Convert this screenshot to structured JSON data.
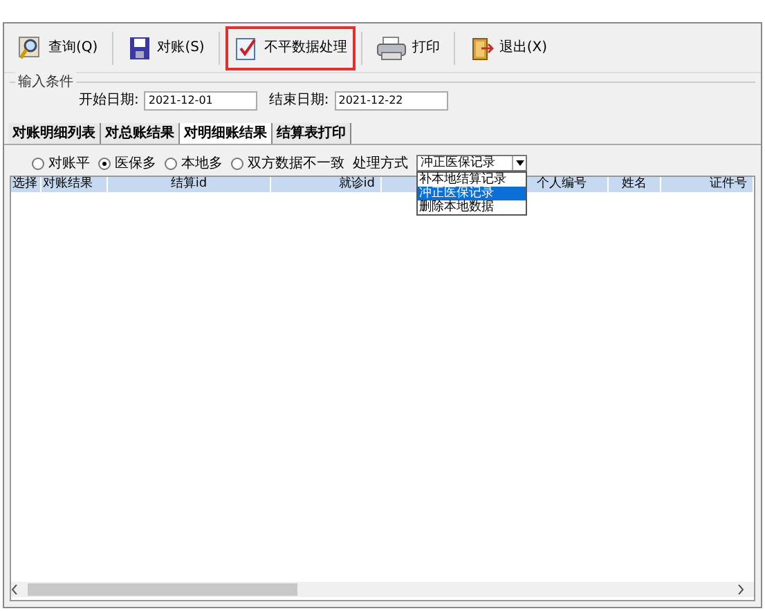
{
  "toolbar": [
    {
      "label": "查询(Q)",
      "highlighted": false
    },
    {
      "label": "对账(S)",
      "highlighted": false
    },
    {
      "label": "不平数据处理",
      "highlighted": true
    },
    {
      "label": "打印",
      "highlighted": false
    },
    {
      "label": "退出(X)",
      "highlighted": false
    }
  ],
  "conditions": {
    "title": "输入条件",
    "start_label": "开始日期:",
    "start_value": "2021-12-01",
    "end_label": "结束日期:",
    "end_value": "2021-12-22"
  },
  "tabs": [
    {
      "label": "对账明细列表",
      "selected": false
    },
    {
      "label": "对总账结果",
      "selected": false
    },
    {
      "label": "对明细账结果",
      "selected": true
    },
    {
      "label": "结算表打印",
      "selected": false
    }
  ],
  "filters": [
    {
      "label": "对账平",
      "selected": false
    },
    {
      "label": "医保多",
      "selected": true
    },
    {
      "label": "本地多",
      "selected": false
    },
    {
      "label": "双方数据不一致",
      "selected": false
    }
  ],
  "method": {
    "label": "处理方式",
    "value": "冲正医保记录",
    "options": [
      {
        "label": "补本地结算记录",
        "selected": false
      },
      {
        "label": "冲正医保记录",
        "selected": true
      },
      {
        "label": "删除本地数据",
        "selected": false
      }
    ]
  },
  "table": {
    "columns": [
      "选择",
      "对账结果",
      "结算id",
      "就诊id",
      "个人编号",
      "姓名",
      "证件号"
    ]
  }
}
